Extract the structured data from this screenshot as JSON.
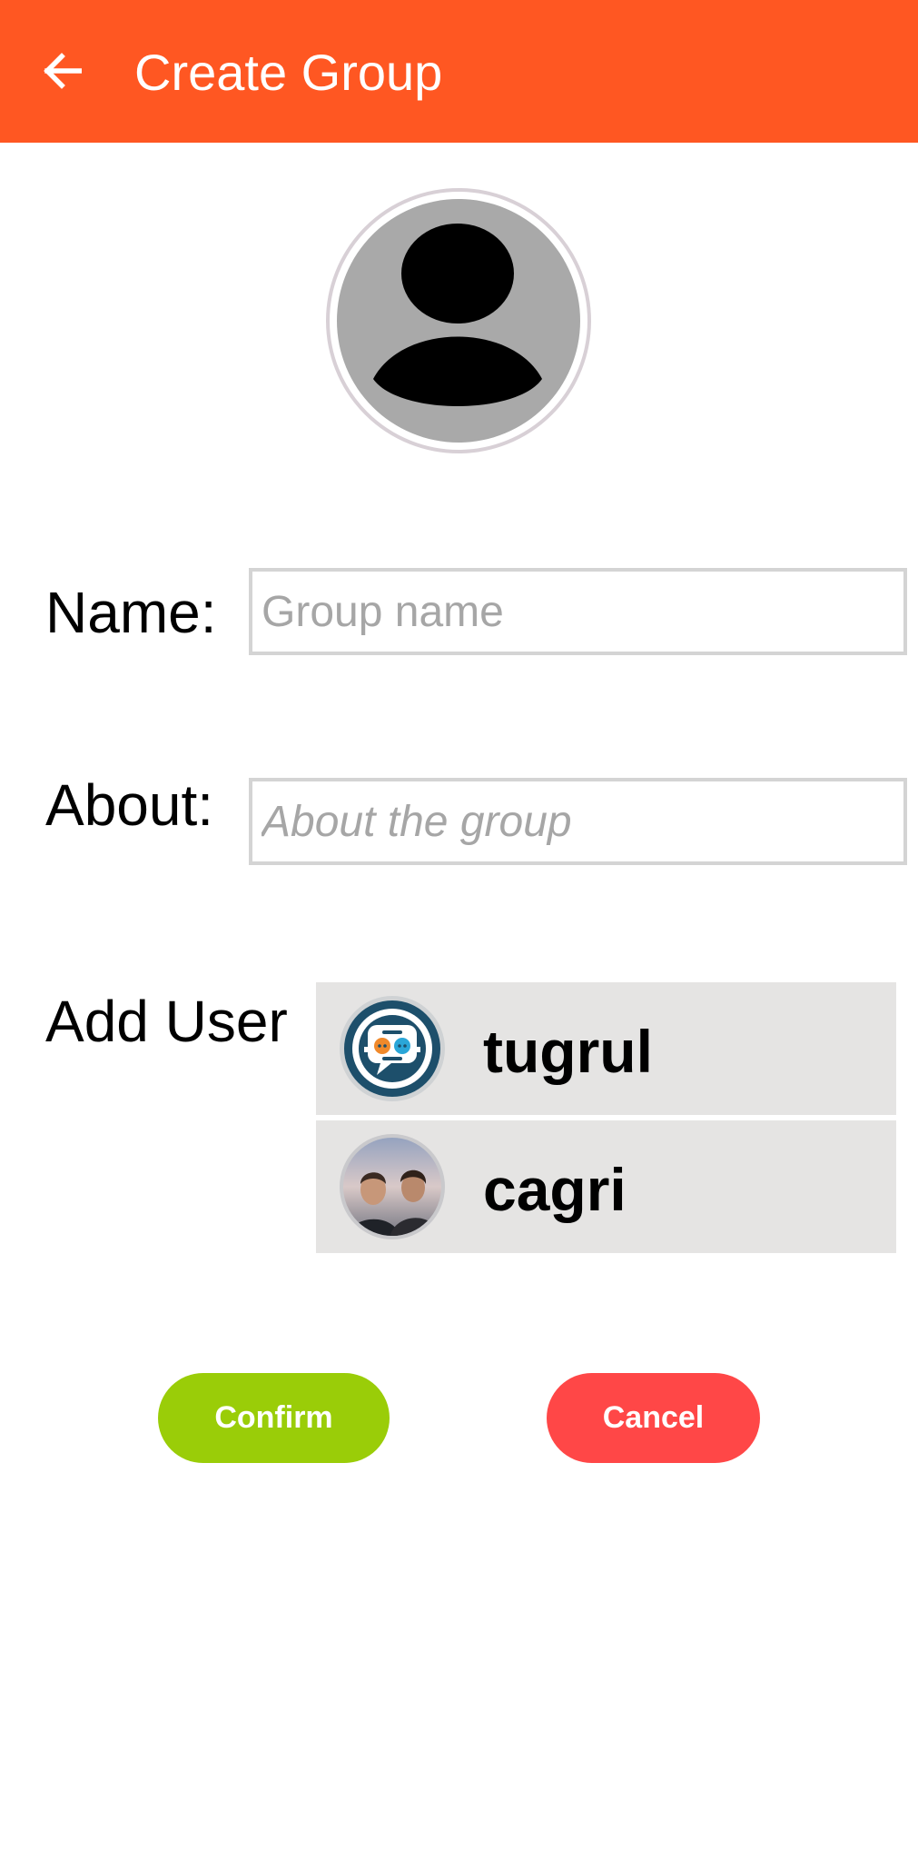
{
  "app_bar": {
    "title": "Create Group",
    "back_icon": "arrow-left-icon",
    "color": "#FF5722"
  },
  "group_avatar": {
    "icon": "person-placeholder-icon"
  },
  "form": {
    "name": {
      "label": "Name:",
      "placeholder": "Group name",
      "value": ""
    },
    "about": {
      "label": "About:",
      "placeholder": "About the group",
      "value": ""
    }
  },
  "add_user": {
    "label": "Add User",
    "users": [
      {
        "name": "tugrul",
        "avatar": "chat-bubbles-logo-icon"
      },
      {
        "name": "cagri",
        "avatar": "photo-two-people"
      }
    ]
  },
  "buttons": {
    "confirm": {
      "label": "Confirm",
      "color": "#9ACD08"
    },
    "cancel": {
      "label": "Cancel",
      "color": "#FF4747"
    }
  }
}
